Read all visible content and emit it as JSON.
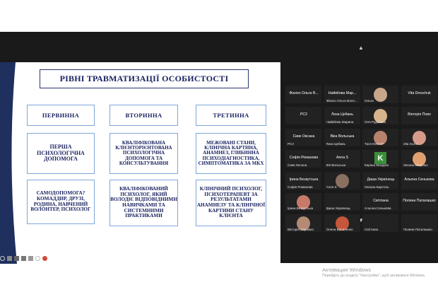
{
  "slide": {
    "title": "РІВНІ ТРАВМАТИЗАЦІЇ ОСОБИСТОСТІ",
    "headers": [
      "ПЕРВИННА",
      "ВТОРИННА",
      "ТРЕТИННА"
    ],
    "row2": [
      "ПЕРША ПСИХОЛОГІЧНА ДОПОМОГА",
      "КВАЛІФІКОВАНА КЛІЄНТОРІЄНТОВАНА ПСИХОЛОГІЧНА ДОПОМОГА ТА КОНСУЛЬТУВАННЯ",
      "МЕЖОВАНІ СТАНИ, КЛІНІЧНА КАРТИНА, АНАМНЕЗ, ГЛИБИННА ПСИХОДІАГНОСТИКА, СИМПТОМАТИКА ЗА МКХ"
    ],
    "row3": [
      "САМОДОПОМОГА? КОМАДДИР, ДРУЗІ, РОДИНА, НАВЧЕНИЙ ВОЛОНТЕР, ПСИХОЛОГ",
      "КВАЛІФІКОВАНИЙ ПСИХОЛОГ, ЯКИЙ ВОЛОДІЄ ВІДПОВІДНИМИ НАВИЧКАМИ ТА СИСТЕМНИМИ ПРАКТИКАМИ",
      "КЛІНІЧНИЙ ПСИХОЛОГ, ПСИХОТЕРАПЕВТ ЗА РЕЗУЛЬТАТАМИ АНАМНЕЗУ ТА КЛІНІЧНОЇ КАРТИНИ СТАНУ КЛІЄНТА"
    ]
  },
  "participants": [
    {
      "big": "Фіалко Ольга В...",
      "name": "",
      "photo": false
    },
    {
      "big": "Найвбова Мар...",
      "name": "Фіалко Ольга Воло...",
      "photo": false
    },
    {
      "big": "",
      "name": "Ольга",
      "photo": true,
      "color": "#c9a58a"
    },
    {
      "big": "Vita Dreschuk",
      "name": "",
      "photo": false
    },
    {
      "big": "РС2",
      "name": "",
      "photo": false
    },
    {
      "big": "Лиза Цебань",
      "name": "Найвбова Марина",
      "photo": false
    },
    {
      "big": "",
      "name": "Оля Руденька",
      "photo": true,
      "color": "#d7b48c"
    },
    {
      "big": "Вікторія Пово",
      "name": "",
      "photo": false
    },
    {
      "big": "Сиик Оксана",
      "name": "РС2",
      "photo": false
    },
    {
      "big": "Віка Вольська",
      "name": "Лиза Цебань",
      "photo": false
    },
    {
      "big": "",
      "name": "Тася КОМАР",
      "photo": true,
      "color": "#b9826c"
    },
    {
      "big": "",
      "name": "Vita Gurol",
      "photo": true,
      "color": "#d89a8a"
    },
    {
      "big": "Софія Романова",
      "name": "Сиик Оксана",
      "photo": false
    },
    {
      "big": "Anna S",
      "name": "Вія Вольська",
      "photo": false
    },
    {
      "big": "",
      "name": "Каріша Мазурок",
      "photo": false,
      "k": "K"
    },
    {
      "big": "",
      "name": "Оксана Міщенко",
      "photo": true,
      "color": "#e0a070"
    },
    {
      "big": "Ірина Безкутська",
      "name": "Софія Романова",
      "photo": false
    },
    {
      "big": "",
      "name": "Anna S",
      "photo": true,
      "color": "#8a7060"
    },
    {
      "big": "Даша Українець",
      "name": "Оксана Бартоль",
      "photo": false
    },
    {
      "big": "Альона Сенькова",
      "name": "",
      "photo": false
    },
    {
      "big": "",
      "name": "Ірина Безкутська",
      "photo": true,
      "color": "#c87a6a"
    },
    {
      "big": "",
      "name": "Даша Українець",
      "photo": false
    },
    {
      "big": "Світлана",
      "name": "Альона Сенькова",
      "photo": false
    },
    {
      "big": "Полина Паталашко",
      "name": "",
      "photo": false
    },
    {
      "big": "",
      "name": "Вікторія Серпівко",
      "photo": true,
      "color": "#b48a74"
    },
    {
      "big": "",
      "name": "Олена Василенко",
      "photo": true,
      "color": "#c4563c"
    },
    {
      "big": "",
      "name": "Світлана",
      "photo": false
    },
    {
      "big": "",
      "name": "Полина Паталашко",
      "photo": false
    }
  ],
  "watermark": {
    "title": "Активация Windows",
    "subtitle": "Перейдіть до розділу \"Настройки\", щоб активувати Windows."
  }
}
